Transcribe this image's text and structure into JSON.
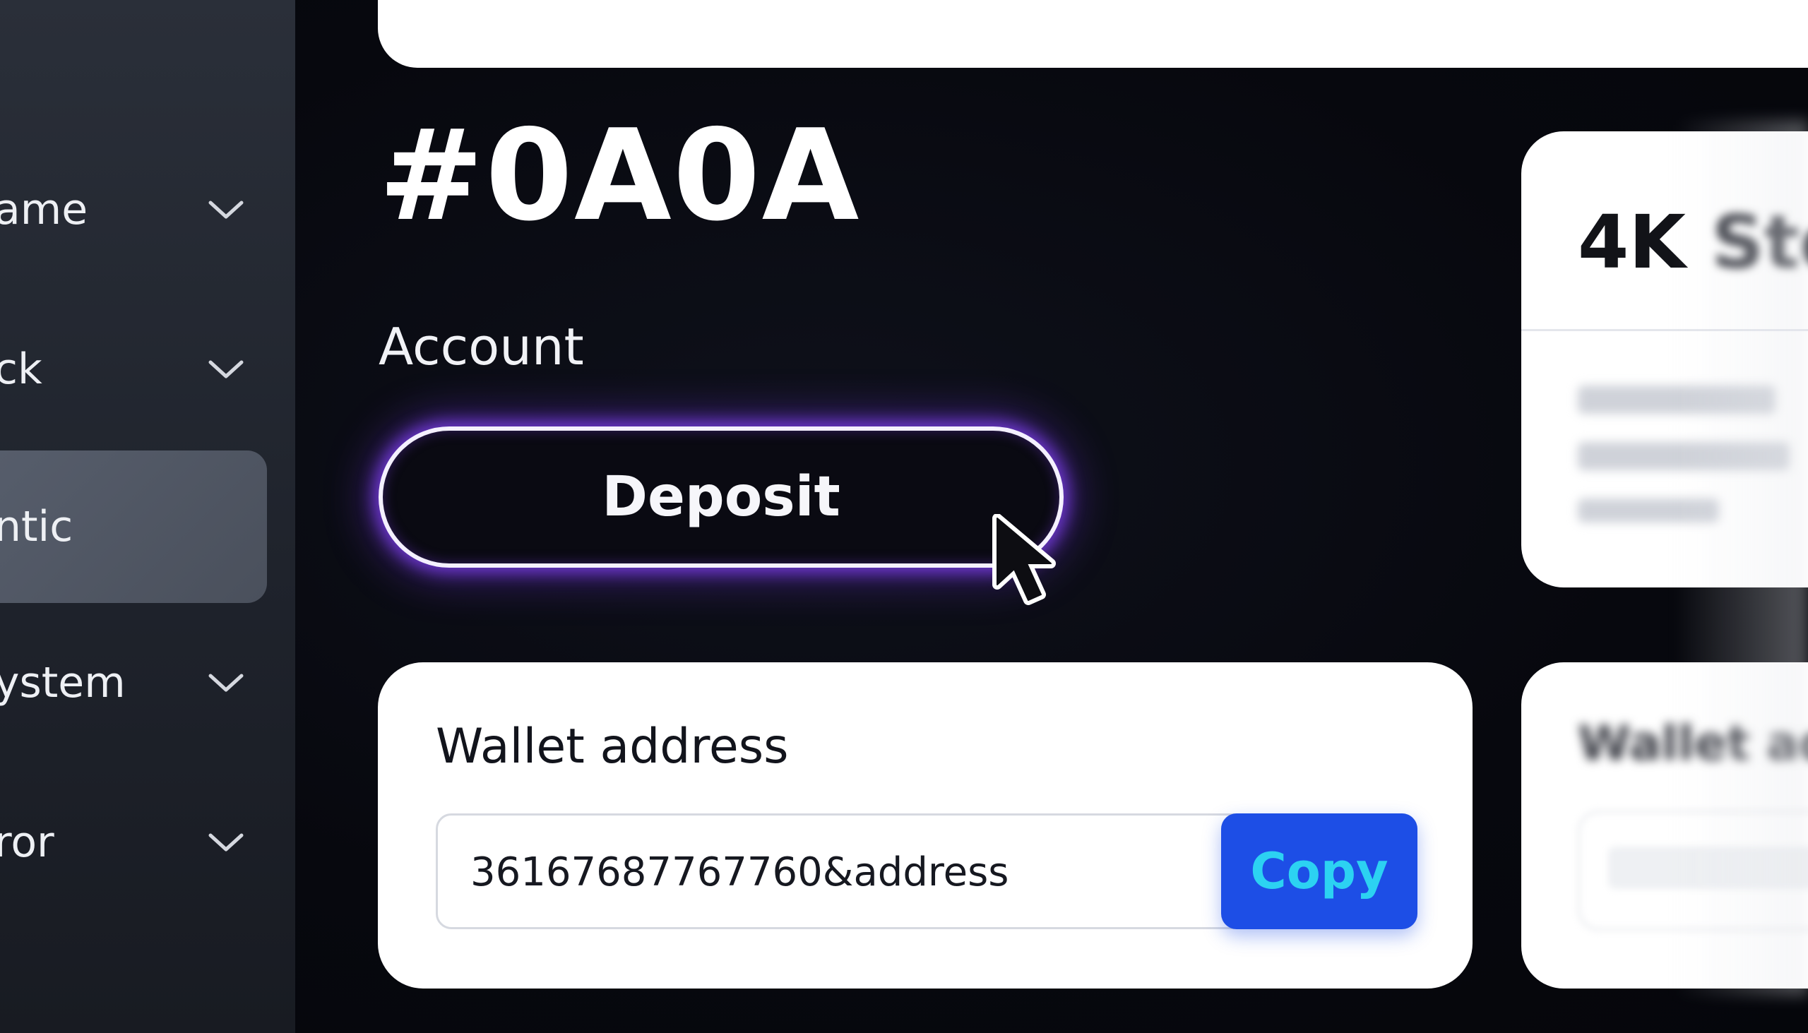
{
  "sidebar": {
    "items": [
      {
        "label": "ame",
        "expandable": true
      },
      {
        "label": "ck",
        "expandable": true
      },
      {
        "label": "ntic",
        "expandable": false,
        "active": true
      },
      {
        "label": "ystem",
        "expandable": true
      },
      {
        "label": "ror",
        "expandable": true
      }
    ]
  },
  "main": {
    "heading": "#0A0A",
    "subheading": "Account",
    "deposit_label": "Deposit",
    "wallet": {
      "title": "Wallet address",
      "value": "36167687767760&address",
      "copy_label": "Copy"
    }
  },
  "right_panel": {
    "card1": {
      "title_visible": "4K",
      "title_blurred": "Ste"
    },
    "card2": {
      "title_blurred": "Wallet ad"
    }
  },
  "colors": {
    "background": "#07080e",
    "sidebar": "#23272f",
    "active_item": "#52596a",
    "deposit_glow": "#7c3aed",
    "copy_button": "#1d4ee6",
    "copy_text": "#2cd2f2"
  },
  "icons": {
    "chevron": "chevron-down-icon",
    "cursor": "mouse-pointer-icon"
  }
}
